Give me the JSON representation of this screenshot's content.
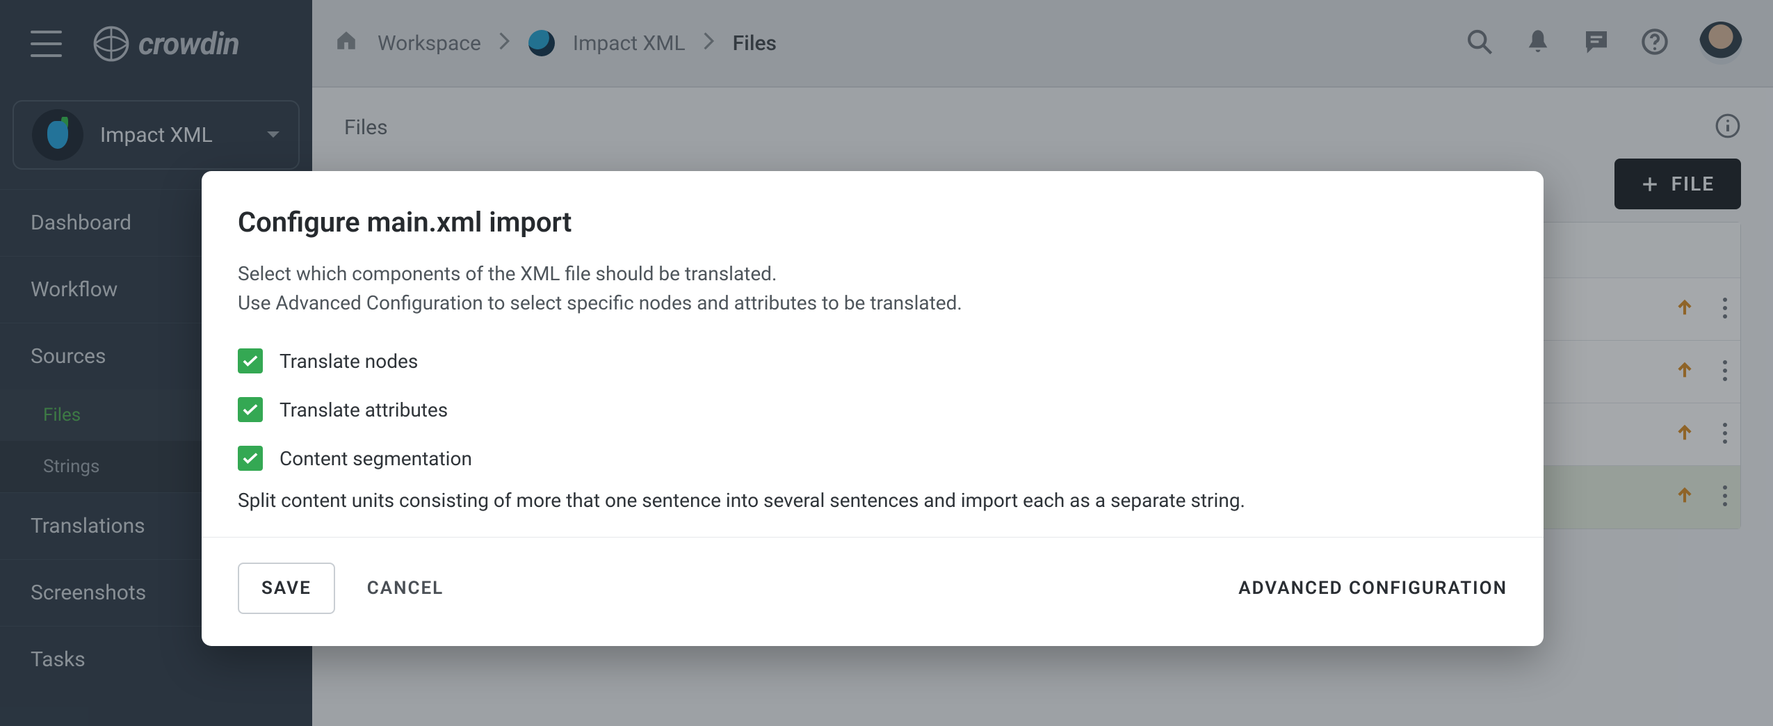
{
  "brand": "crowdin",
  "breadcrumb": {
    "workspace": "Workspace",
    "project": "Impact XML",
    "current": "Files"
  },
  "sidebar": {
    "project_name": "Impact XML",
    "items": [
      {
        "label": "Dashboard"
      },
      {
        "label": "Workflow"
      },
      {
        "label": "Sources"
      },
      {
        "label": "Translations"
      },
      {
        "label": "Screenshots"
      },
      {
        "label": "Tasks"
      }
    ],
    "sources_sub": [
      {
        "label": "Files",
        "active": true
      },
      {
        "label": "Strings",
        "active": false
      }
    ]
  },
  "page": {
    "title": "Files",
    "file_button": "FILE"
  },
  "dialog": {
    "title": "Configure main.xml import",
    "desc_line1": "Select which components of the XML file should be translated.",
    "desc_line2": "Use Advanced Configuration to select specific nodes and attributes to be translated.",
    "checks": {
      "translate_nodes": "Translate nodes",
      "translate_attributes": "Translate attributes",
      "content_segmentation": "Content segmentation"
    },
    "segmentation_note": "Split content units consisting of more that one sentence into several sentences and import each as a separate string.",
    "save": "SAVE",
    "cancel": "CANCEL",
    "advanced": "ADVANCED CONFIGURATION"
  }
}
